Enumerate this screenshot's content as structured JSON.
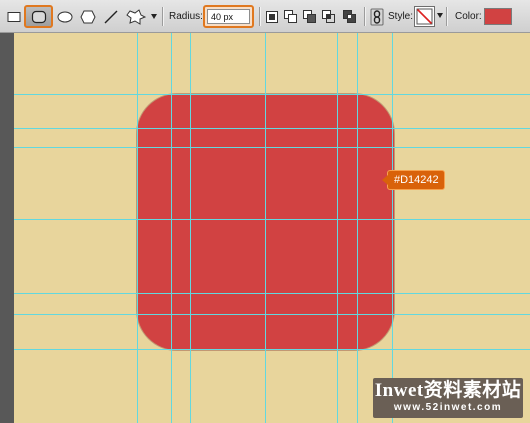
{
  "toolbar": {
    "tools": [
      {
        "name": "rectangle-tool-icon",
        "active": false
      },
      {
        "name": "rounded-rectangle-tool-icon",
        "active": true
      },
      {
        "name": "ellipse-tool-icon",
        "active": false
      },
      {
        "name": "polygon-tool-icon",
        "active": false
      },
      {
        "name": "line-tool-icon",
        "active": false
      },
      {
        "name": "custom-shape-tool-icon",
        "active": false
      }
    ],
    "radius_label": "Radius:",
    "radius_value": "40 px",
    "path_ops": [
      "new-shape-layer-icon",
      "add-to-shape-icon",
      "subtract-shape-icon",
      "intersect-shape-icon",
      "exclude-overlap-icon"
    ],
    "link_icon": "link-layer-style-icon",
    "style_label": "Style:",
    "style_value_icon": "no-style-icon",
    "color_label": "Color:",
    "color_value": "#D14242"
  },
  "canvas": {
    "background": "#E8D59C",
    "shape_color": "#D14242",
    "guide_color": "#62D8DF"
  },
  "tooltip": {
    "text": "#D14242"
  },
  "watermark": {
    "brand": "Inwet资料素材站",
    "url": "www.52inwet.com"
  }
}
